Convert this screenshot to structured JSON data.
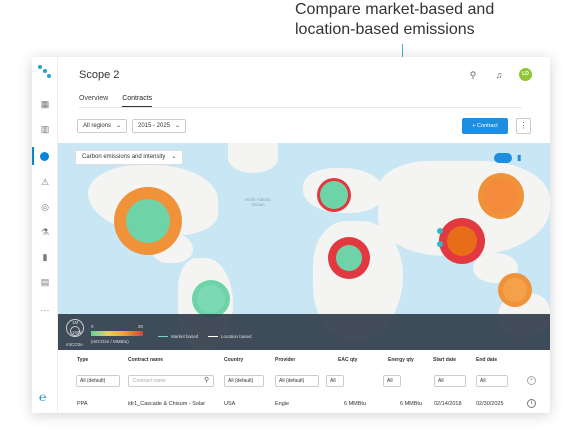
{
  "callout": {
    "line1": "Compare market-based and",
    "line2": "location-based emissions"
  },
  "app": {
    "title": "Scope 2",
    "avatar_initials": "LD"
  },
  "tabs": [
    {
      "label": "Overview"
    },
    {
      "label": "Contracts"
    }
  ],
  "filters": {
    "region": "All regions",
    "years": "2015 - 2025"
  },
  "toolbar": {
    "add_label": "+ Contract",
    "more_label": "⋮"
  },
  "map": {
    "layer_select": "Carbon emissions and intensity",
    "ocean_label": "North Atlantic Ocean"
  },
  "legend": {
    "circle_unit": "mtCO2e",
    "circle_big": "1M",
    "circle_small": "100k",
    "gradient_min": "0",
    "gradient_max": "30",
    "gradient_unit": "(mtCO2e / MMBtu)",
    "market_label": "Market based",
    "location_label": "Location based"
  },
  "table": {
    "columns": [
      "Type",
      "Contract name",
      "Country",
      "Provider",
      "EAC qty",
      "Energy qty",
      "Start date",
      "End date"
    ],
    "filter_all": "All (default)",
    "filter_short": "All",
    "contract_placeholder": "Contract name",
    "rows": [
      {
        "type": "PPA",
        "name": "idr1_Cascade & Chisum - Solar",
        "country": "USA",
        "provider": "Engie",
        "eac": "6 MMBtu",
        "energy": "6 MMBtu",
        "start": "02/14/2018",
        "end": "02/30/2025"
      }
    ]
  },
  "colors": {
    "accent": "#1e8fe0",
    "callout": "#33b5c5",
    "orange": "#f0923a",
    "red": "#e2383f",
    "green": "#6fd3a8"
  }
}
